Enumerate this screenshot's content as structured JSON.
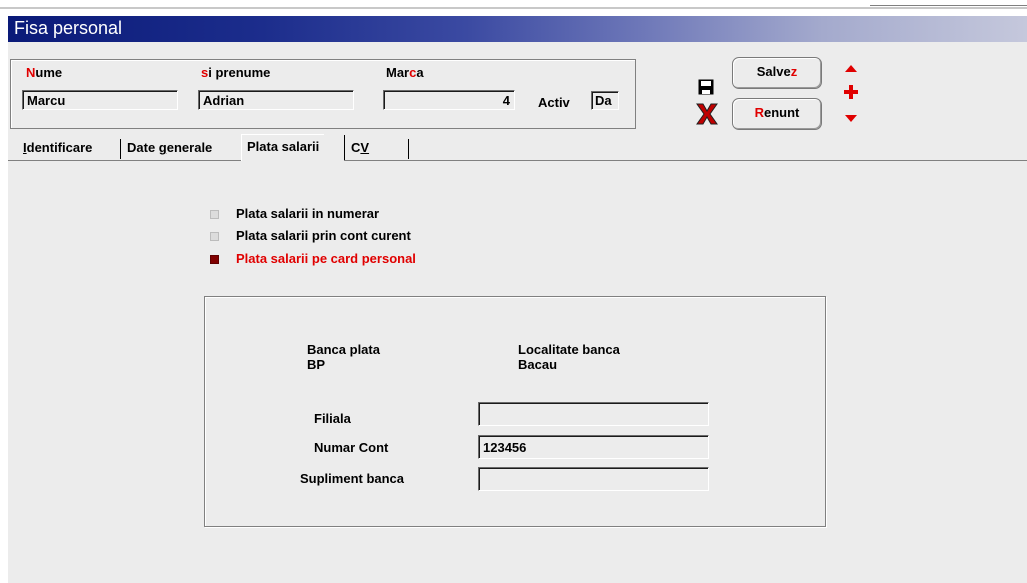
{
  "window": {
    "title": "Fisa personal"
  },
  "header": {
    "nume": {
      "first_letter": "N",
      "rest": "ume",
      "value": "Marcu"
    },
    "prenume": {
      "first_letter": "s",
      "rest": "i prenume",
      "value": "Adrian"
    },
    "marca": {
      "prefix": "Mar",
      "accent": "c",
      "suffix": "a",
      "value": "4"
    },
    "activ": {
      "label": "Activ",
      "value": "Da"
    }
  },
  "toolbar": {
    "save": {
      "prefix": "Salve",
      "accent": "z"
    },
    "cancel": {
      "accent": "R",
      "suffix": "enunt"
    }
  },
  "tabs": [
    {
      "accent": "I",
      "rest": "dentificare"
    },
    {
      "prefix": "Date ",
      "accent": "g",
      "rest": "enerale"
    },
    {
      "label": "Plata salarii"
    },
    {
      "prefix": "C",
      "accent": "V"
    }
  ],
  "payment": {
    "options": [
      {
        "label": "Plata salarii in numerar",
        "selected": false
      },
      {
        "label": "Plata salarii prin cont curent",
        "selected": false
      },
      {
        "label": "Plata salarii pe card personal",
        "selected": true
      }
    ]
  },
  "bank": {
    "banca_label": "Banca plata",
    "banca_value": "BP",
    "localitate_label": "Localitate banca",
    "localitate_value": "Bacau",
    "filiala_label": "Filiala",
    "filiala_value": "",
    "cont_label": "Numar Cont",
    "cont_value": "123456",
    "supliment_label": "Supliment banca",
    "supliment_value": ""
  },
  "colors": {
    "accent_red": "#e00000",
    "selected_radio": "#800000",
    "title_dark": "#0a1a78"
  },
  "icons": [
    "save-disk-icon",
    "cancel-x-icon",
    "arrow-up-icon",
    "add-plus-icon",
    "arrow-down-icon"
  ]
}
